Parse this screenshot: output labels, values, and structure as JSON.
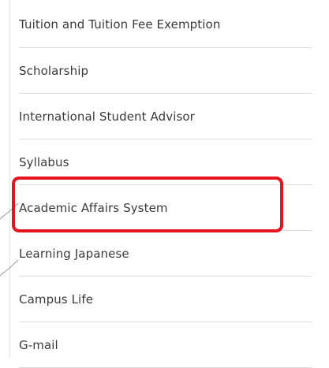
{
  "menu": {
    "items": [
      {
        "label": "Tuition and Tuition Fee Exemption"
      },
      {
        "label": "Scholarship"
      },
      {
        "label": "International Student Advisor"
      },
      {
        "label": "Syllabus"
      },
      {
        "label": "Academic Affairs System",
        "highlighted": true
      },
      {
        "label": "Learning Japanese"
      },
      {
        "label": "Campus Life"
      },
      {
        "label": "G-mail"
      }
    ]
  },
  "annotation": {
    "highlight_color": "#e5141f"
  }
}
